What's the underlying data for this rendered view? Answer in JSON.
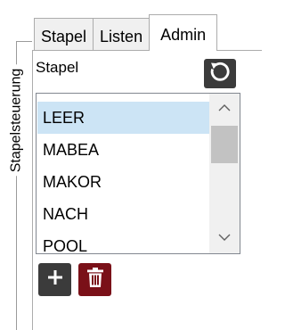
{
  "group": {
    "label": "Stapelsteuerung"
  },
  "tabs": [
    {
      "label": "Stapel",
      "active": false
    },
    {
      "label": "Listen",
      "active": false
    },
    {
      "label": "Admin",
      "active": true
    }
  ],
  "stapel_panel": {
    "label": "Stapel",
    "refresh_icon": "refresh-icon",
    "list": {
      "items": [
        "LEER",
        "MABEA",
        "MAKOR",
        "NACH",
        "POOL"
      ],
      "selected": "LEER"
    },
    "add_icon": "plus-icon",
    "delete_icon": "trash-icon"
  },
  "colors": {
    "dark_button": "#3b3b3b",
    "delete_button": "#7a1018",
    "selection": "#cce4f5"
  }
}
